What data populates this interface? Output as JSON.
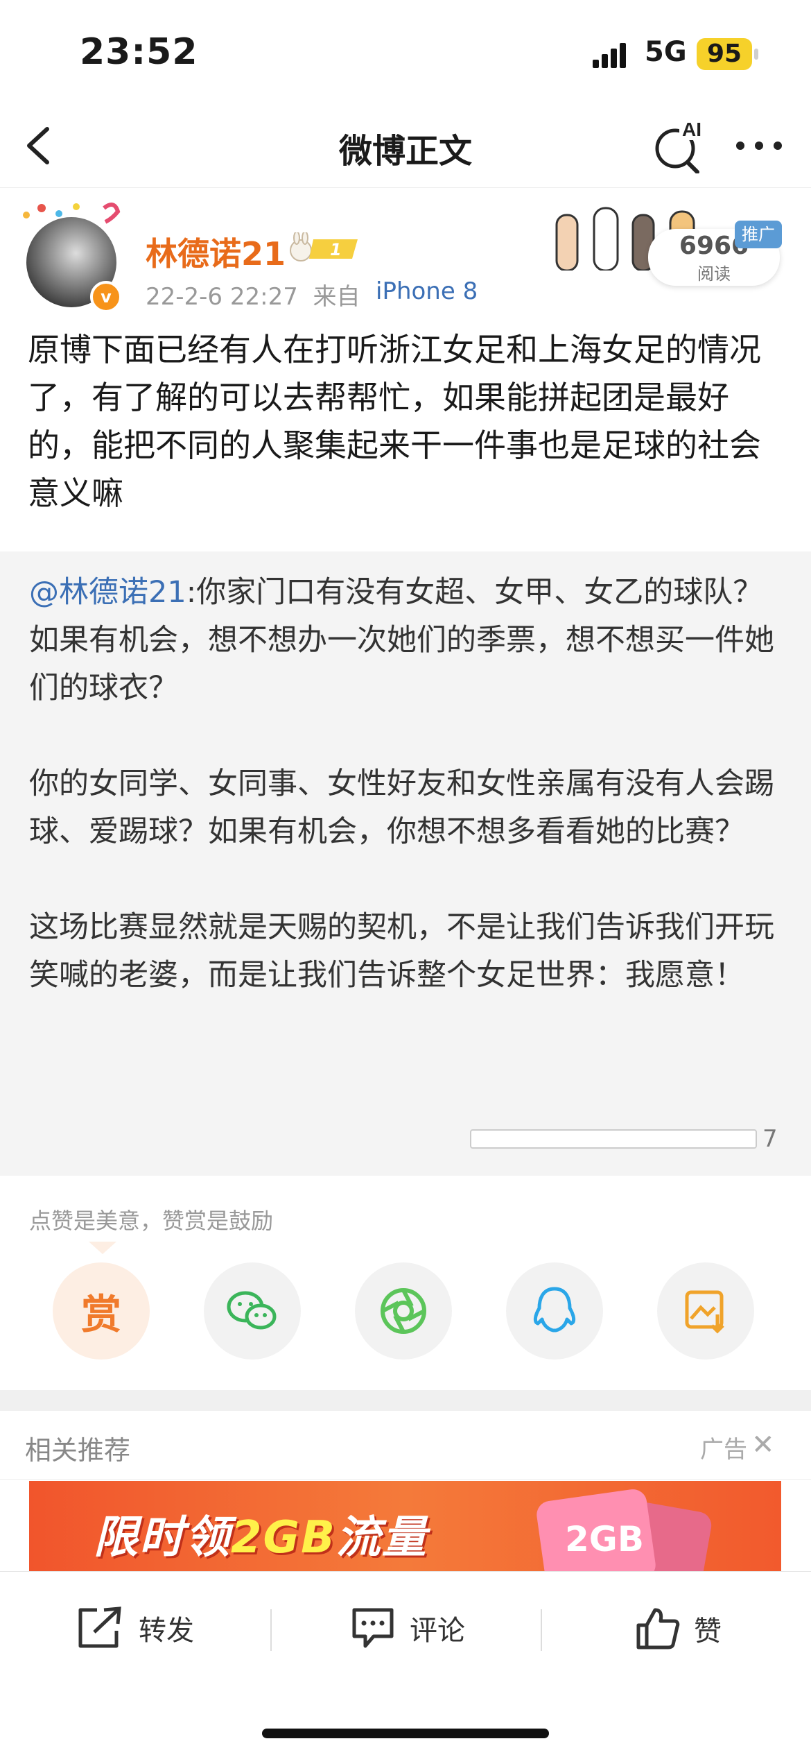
{
  "status_bar": {
    "time": "23:52",
    "network": "5G",
    "battery": "95"
  },
  "nav": {
    "title": "微博正文",
    "ai_label": "AI"
  },
  "author": {
    "name": "林德诺21",
    "badge_level": "1",
    "time": "22-2-6 22:27",
    "source_prefix": "来自",
    "source": "iPhone 8"
  },
  "read_count": {
    "value": "6966",
    "label": "阅读",
    "promo": "推广"
  },
  "post": {
    "text": "原博下面已经有人在打听浙江女足和上海女足的情况了，有了解的可以去帮帮忙，如果能拼起团是最好的，能把不同的人聚集起来干一件事也是足球的社会意义嘛"
  },
  "quote": {
    "mention": "@林德诺21",
    "text": ":你家门口有没有女超、女甲、女乙的球队？如果有机会，想不想办一次她们的季票，想不想买一件她们的球衣？\n\n你的女同学、女同事、女性好友和女性亲属有没有人会踢球、爱踢球？如果有机会，你想不想多看看她的比赛？\n\n这场比赛显然就是天赐的契机，不是让我们告诉我们开玩笑喊的老婆，而是让我们告诉整个女足世界：我愿意！",
    "page_count": "7"
  },
  "reward": {
    "hint": "点赞是美意，赞赏是鼓励",
    "reward_label": "赏",
    "share_targets": [
      "wechat-icon",
      "moments-icon",
      "qq-icon",
      "save-image-icon"
    ]
  },
  "related": {
    "title": "相关推荐",
    "ad_label": "广告",
    "close": "✕"
  },
  "ad": {
    "text_prefix": "限时领",
    "text_highlight": "2GB",
    "text_suffix": "流量",
    "card": "2GB"
  },
  "actions": {
    "repost": "转发",
    "comment": "评论",
    "like": "赞"
  },
  "colors": {
    "accent_orange": "#e86b1a",
    "link_blue": "#3b6fb5"
  }
}
